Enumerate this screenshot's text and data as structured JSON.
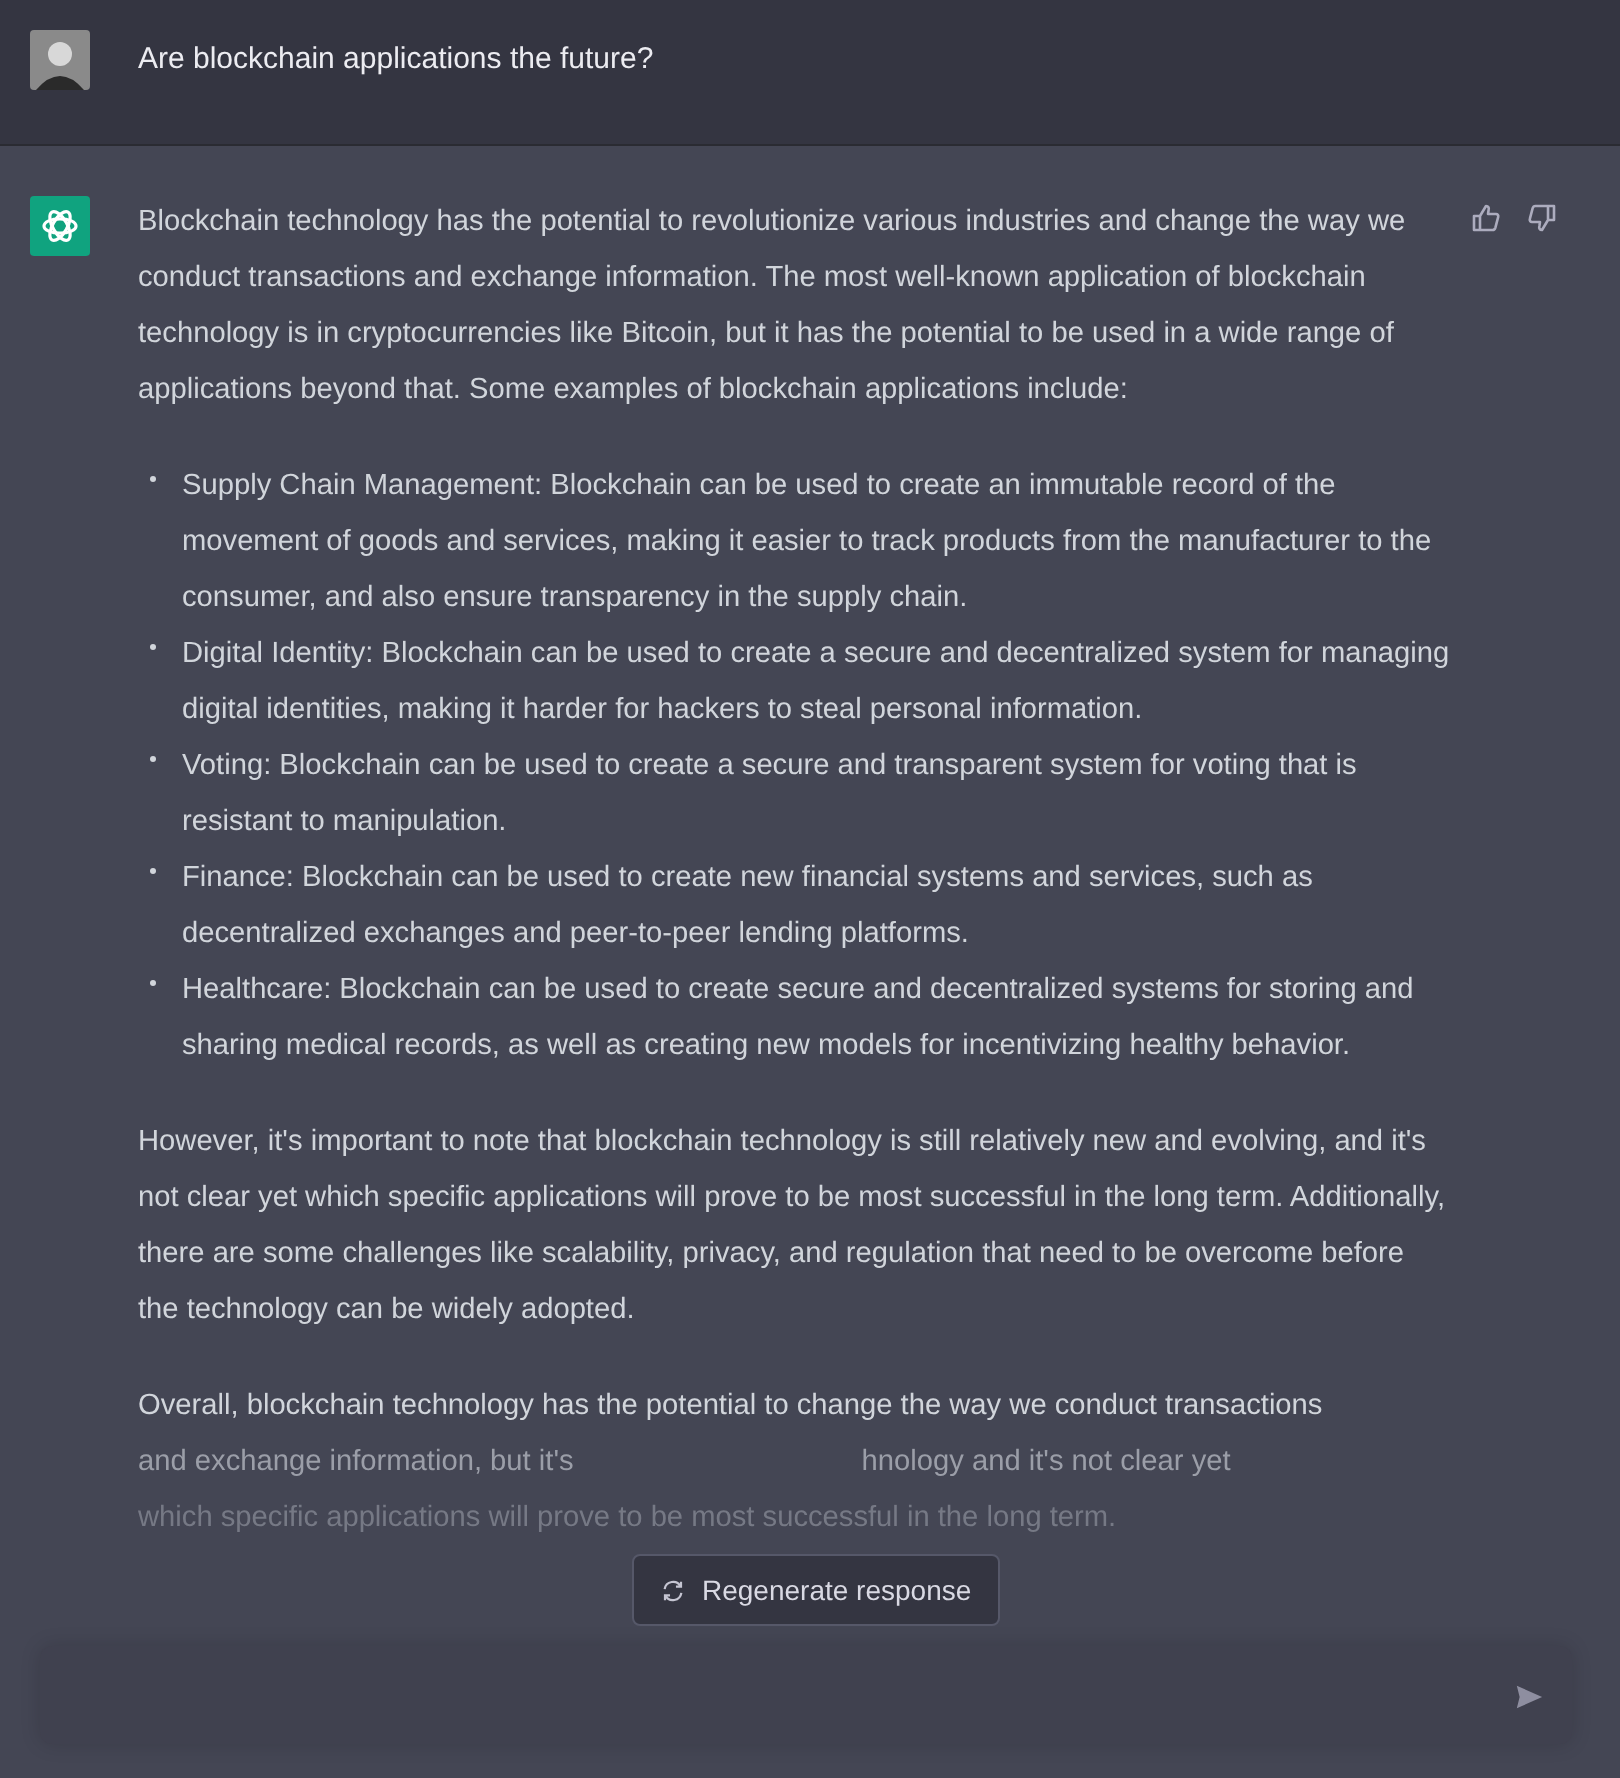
{
  "question": {
    "text": "Are blockchain applications the future?"
  },
  "answer": {
    "intro": "Blockchain technology has the potential to revolutionize various industries and change the way we conduct transactions and exchange information. The most well-known application of blockchain technology is in cryptocurrencies like Bitcoin, but it has the potential to be used in a wide range of applications beyond that. Some examples of blockchain applications include:",
    "bullets": [
      "Supply Chain Management: Blockchain can be used to create an immutable record of the movement of goods and services, making it easier to track products from the manufacturer to the consumer, and also ensure transparency in the supply chain.",
      "Digital Identity: Blockchain can be used to create a secure and decentralized system for managing digital identities, making it harder for hackers to steal personal information.",
      "Voting: Blockchain can be used to create a secure and transparent system for voting that is resistant to manipulation.",
      "Finance: Blockchain can be used to create new financial systems and services, such as decentralized exchanges and peer-to-peer lending platforms.",
      "Healthcare: Blockchain can be used to create secure and decentralized systems for storing and sharing medical records, as well as creating new models for incentivizing healthy behavior."
    ],
    "paragraph": "However, it's important to note that blockchain technology is still relatively new and evolving, and it's not clear yet which specific applications will prove to be most successful in the long term. Additionally, there are some challenges like scalability, privacy, and regulation that need to be overcome before the technology can be widely adopted.",
    "faded_lines": [
      [
        "Overall, blockchain technology has the potential to change the way we conduct transactions"
      ],
      [
        "and exchange information, but it's",
        "hnology and it's not clear yet"
      ],
      [
        "which specific applications will prove to be most successful in the long term."
      ]
    ]
  },
  "regenerate_button": {
    "label": "Regenerate response"
  }
}
